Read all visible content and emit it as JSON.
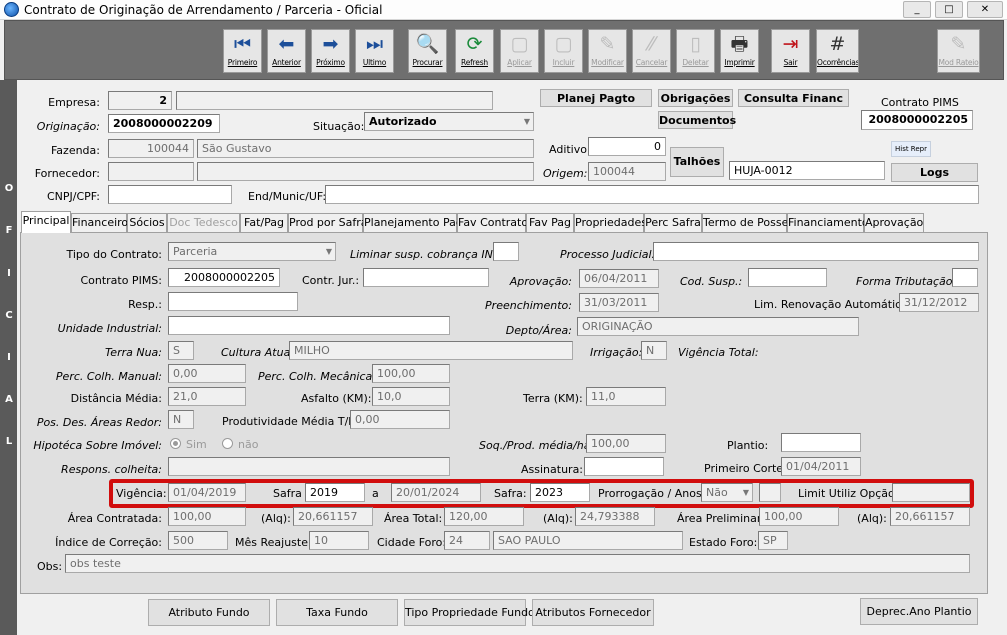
{
  "window": {
    "title": "Contrato de Originação de Arrendamento / Parceria - Oficial",
    "minimize": "_",
    "maximize": "□",
    "close": "✕"
  },
  "toolbar": {
    "primeiro": "Primeiro",
    "anterior": "Anterior",
    "proximo": "Próximo",
    "ultimo": "Ultimo",
    "procurar": "Procurar",
    "refresh": "Refresh",
    "aplicar": "Aplicar",
    "incluir": "Incluir",
    "modificar": "Modificar",
    "cancelar": "Cancelar",
    "deletar": "Deletar",
    "imprimir": "Imprimir",
    "sair": "Sair",
    "ocorrencias": "Ocorrências",
    "mod_rateio": "Mod Rateio"
  },
  "side_label": [
    "O",
    "F",
    "I",
    "C",
    "I",
    "A",
    "L"
  ],
  "header": {
    "empresa_label": "Empresa:",
    "empresa_value": "2",
    "empresa_name": "",
    "originacao_label": "Originação:",
    "originacao_value": "2008000002209",
    "situacao_label": "Situação:",
    "situacao_value": "Autorizado",
    "fazenda_label": "Fazenda:",
    "fazenda_code": "100044",
    "fazenda_name": "São Gustavo",
    "fornecedor_label": "Fornecedor:",
    "fornecedor_code": "",
    "fornecedor_name": "",
    "cnpj_label": "CNPJ/CPF:",
    "cnpj_value": "",
    "endereco_label": "End/Munic/UF:",
    "endereco_value": "",
    "planej_pagto": "Planej Pagto",
    "obrigacoes": "Obrigações",
    "consulta_financ": "Consulta Financ",
    "documentos": "Documentos",
    "contrato_pims_label": "Contrato PIMS",
    "contrato_pims_value": "2008000002205",
    "aditivo_label": "Aditivo:",
    "aditivo_value": "0",
    "origem_label": "Origem:",
    "origem_value": "100044",
    "talhoes": "Talhões",
    "talhao_value": "HUJA-0012",
    "hist_repr": "Hist Repr",
    "logs": "Logs"
  },
  "tabs": [
    "Principal",
    "Financeiro",
    "Sócios",
    "Doc Tedesco",
    "Fat/Pag",
    "Prod por Safra",
    "Planejamento Pag",
    "Fav Contrato",
    "Fav Pag",
    "Propriedades",
    "Perc Safra",
    "Termo de Posse",
    "Financiamento",
    "Aprovação"
  ],
  "form": {
    "tipo_contrato_label": "Tipo do Contrato:",
    "tipo_contrato_value": "Parceria",
    "liminar_label": "Liminar susp. cobrança INS:",
    "liminar_value": "",
    "processo_label": "Processo Judicial:",
    "processo_value": "",
    "contrato_pims_label": "Contrato PIMS:",
    "contrato_pims_value": "2008000002205",
    "contr_jur_label": "Contr. Jur.:",
    "contr_jur_value": "",
    "aprovacao_label": "Aprovação:",
    "aprovacao_value": "06/04/2011",
    "cod_susp_label": "Cod. Susp.:",
    "cod_susp_value": "",
    "forma_trib_label": "Forma Tributação:",
    "forma_trib_value": "",
    "resp_label": "Resp.:",
    "resp_value": "",
    "preenchimento_label": "Preenchimento:",
    "preenchimento_value": "31/03/2011",
    "lim_renov_label": "Lim. Renovação Automática:",
    "lim_renov_value": "31/12/2012",
    "unidade_label": "Unidade Industrial:",
    "unidade_value": "",
    "depto_label": "Depto/Área:",
    "depto_value": "ORIGINAÇÃO",
    "terra_nua_label": "Terra Nua:",
    "terra_nua_value": "S",
    "cultura_label": "Cultura Atual:",
    "cultura_value": "MILHO",
    "irrigacao_label": "Irrigação:",
    "irrigacao_value": "N",
    "vigencia_total_label": "Vigência Total:",
    "perc_manual_label": "Perc. Colh. Manual:",
    "perc_manual_value": "0,00",
    "perc_mecanica_label": "Perc. Colh. Mecânica:",
    "perc_mecanica_value": "100,00",
    "distancia_label": "Distância Média:",
    "distancia_value": "21,0",
    "asfalto_label": "Asfalto (KM):",
    "asfalto_value": "10,0",
    "terra_km_label": "Terra (KM):",
    "terra_km_value": "11,0",
    "pos_des_label": "Pos. Des. Áreas Redor:",
    "pos_des_value": "N",
    "produtividade_label": "Produtividade Média T/ha:",
    "produtividade_value": "0,00",
    "hipoteca_label": "Hipotéca Sobre Imóvel:",
    "hipoteca_sim": "Sim",
    "hipoteca_nao": "não",
    "soq_label": "Soq./Prod. média/ha:",
    "soq_value": "100,00",
    "plantio_label": "Plantio:",
    "plantio_value": "",
    "respons_label": "Respons. colheita:",
    "respons_value": "",
    "assinatura_label": "Assinatura:",
    "assinatura_value": "",
    "primeiro_corte_label": "Primeiro Corte:",
    "primeiro_corte_value": "01/04/2011",
    "vigencia_label": "Vigência:",
    "vigencia_value": "01/04/2019",
    "safra_label": "Safra",
    "safra_value": "2019",
    "a_label": "a",
    "vigencia_fim_value": "20/01/2024",
    "safra2_label": "Safra:",
    "safra2_value": "2023",
    "prorrogacao_label": "Prorrogação / Anos:",
    "prorrogacao_value": "Não",
    "prorrogacao_anos": "",
    "limit_label": "Limit Utiliz Opção:",
    "limit_value": "",
    "area_contratada_label": "Área Contratada:",
    "area_contratada_value": "100,00",
    "alq1_label": "(Alq):",
    "alq1_value": "20,661157",
    "area_total_label": "Área Total:",
    "area_total_value": "120,00",
    "alq2_label": "(Alq):",
    "alq2_value": "24,793388",
    "area_prelim_label": "Área Preliminar:",
    "area_prelim_value": "100,00",
    "alq3_label": "(Alq):",
    "alq3_value": "20,661157",
    "indice_label": "Índice de Correção:",
    "indice_value": "500",
    "mes_label": "Mês Reajuste:",
    "mes_value": "10",
    "cidade_label": "Cidade Foro:",
    "cidade_code": "24",
    "cidade_name": "SAO PAULO",
    "estado_label": "Estado Foro:",
    "estado_value": "SP",
    "obs_label": "Obs:",
    "obs_value": "obs teste"
  },
  "footer": {
    "atributo_fundo": "Atributo Fundo",
    "taxa_fundo": "Taxa Fundo",
    "tipo_propriedade": "Tipo Propriedade Fundo",
    "atributos_fornecedor": "Atributos Fornecedor",
    "deprec": "Deprec.Ano Plantio"
  }
}
